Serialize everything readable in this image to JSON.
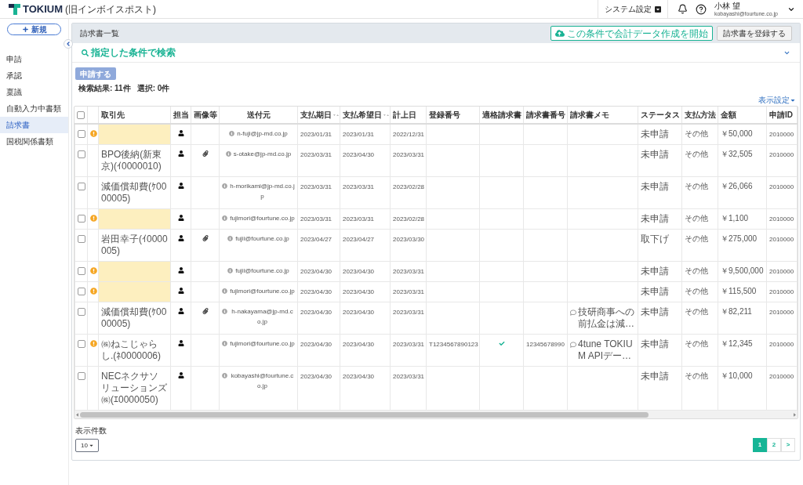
{
  "app": {
    "logo": "TOKIUM",
    "logo_note": "(旧インボイスポスト)",
    "system_settings": "システム設定",
    "user_name": "小林 望",
    "user_email": "kobayashi@fourtune.co.jp"
  },
  "sidebar": {
    "new_button": "新規",
    "items": [
      {
        "label": "申請",
        "selected": false
      },
      {
        "label": "承認",
        "selected": false
      },
      {
        "label": "稟議",
        "selected": false
      },
      {
        "label": "自動入力中書類",
        "selected": false
      },
      {
        "label": "請求書",
        "selected": true
      },
      {
        "label": "国税関係書類",
        "selected": false
      }
    ]
  },
  "panel": {
    "title": "請求書一覧",
    "export_button": "この条件で会計データ作成を開始",
    "register_button": "請求書を登録する"
  },
  "search": {
    "label": "指定した条件で検索",
    "expanded": false
  },
  "toolbar": {
    "apply_button": {
      "label": "申請する",
      "disabled": true
    },
    "result_count": "検索結果: 11件",
    "selection_count": "選択: 0件",
    "display_settings": "表示設定"
  },
  "table": {
    "select_all": {
      "checked": false
    },
    "columns": [
      {
        "label": "取引先",
        "sortable": false
      },
      {
        "label": "担当",
        "sortable": false
      },
      {
        "label": "画像等",
        "sortable": false
      },
      {
        "label": "送付元",
        "sortable": false
      },
      {
        "label": "支払期日",
        "sortable": true
      },
      {
        "label": "支払希望日",
        "sortable": true
      },
      {
        "label": "計上日",
        "sortable": false
      },
      {
        "label": "登録番号",
        "sortable": false
      },
      {
        "label": "適格請求書",
        "sortable": false
      },
      {
        "label": "請求書番号",
        "sortable": false
      },
      {
        "label": "請求書メモ",
        "sortable": false
      },
      {
        "label": "ステータス",
        "sortable": false
      },
      {
        "label": "支払方法",
        "sortable": false
      },
      {
        "label": "金額",
        "sortable": false
      },
      {
        "label": "申請ID",
        "sortable": false
      }
    ],
    "rows": [
      {
        "checked": false,
        "warning": true,
        "assigned": true,
        "attachment": false,
        "sender": "n-fuji@jp-md.co.jp",
        "due_date": "2023/01/31",
        "desired_date": "2023/01/31",
        "posting_date": "2022/12/31",
        "qualified": false,
        "status": "未申請",
        "payment_method": "その他",
        "amount": "￥50,000",
        "application_id": "2010000"
      },
      {
        "checked": false,
        "warning": false,
        "partner": "BPO後納(新東京)(ｲ0000010)",
        "assigned": true,
        "attachment": true,
        "sender": "s-otake@jp-md.co.jp",
        "due_date": "2023/03/31",
        "desired_date": "2023/04/30",
        "posting_date": "2023/03/31",
        "qualified": false,
        "status": "未申請",
        "payment_method": "その他",
        "amount": "￥32,505",
        "application_id": "2010000"
      },
      {
        "checked": false,
        "warning": false,
        "partner": "減価償却費(ｹ0000005)",
        "assigned": true,
        "attachment": false,
        "sender": "h-morikami@jp-md.co.jp",
        "due_date": "2023/03/31",
        "desired_date": "2023/03/31",
        "posting_date": "2023/02/28",
        "qualified": false,
        "status": "未申請",
        "payment_method": "その他",
        "amount": "￥26,066",
        "application_id": "2010000"
      },
      {
        "checked": false,
        "warning": true,
        "assigned": true,
        "attachment": false,
        "sender": "fujimori@fourtune.co.jp",
        "due_date": "2023/03/31",
        "desired_date": "2023/03/31",
        "posting_date": "2023/02/28",
        "qualified": false,
        "status": "未申請",
        "payment_method": "その他",
        "amount": "￥1,100",
        "application_id": "2010000"
      },
      {
        "checked": false,
        "warning": false,
        "partner": "岩田幸子(ｲ0000005)",
        "assigned": true,
        "attachment": true,
        "sender": "fujii@fourtune.co.jp",
        "due_date": "2023/04/27",
        "desired_date": "2023/04/27",
        "posting_date": "2023/03/30",
        "qualified": false,
        "status": "取下げ",
        "payment_method": "その他",
        "amount": "￥275,000",
        "application_id": "2010000"
      },
      {
        "checked": false,
        "warning": true,
        "assigned": true,
        "attachment": false,
        "sender": "fujii@fourtune.co.jp",
        "due_date": "2023/04/30",
        "desired_date": "2023/04/30",
        "posting_date": "2023/03/31",
        "qualified": false,
        "status": "未申請",
        "payment_method": "その他",
        "amount": "￥9,500,000",
        "application_id": "2010000"
      },
      {
        "checked": false,
        "warning": true,
        "assigned": true,
        "attachment": false,
        "sender": "fujimori@fourtune.co.jp",
        "due_date": "2023/04/30",
        "desired_date": "2023/04/30",
        "posting_date": "2023/03/31",
        "qualified": false,
        "status": "未申請",
        "payment_method": "その他",
        "amount": "￥115,500",
        "application_id": "2010000"
      },
      {
        "checked": false,
        "warning": false,
        "partner": "減価償却費(ｹ0000005)",
        "assigned": true,
        "attachment": true,
        "sender": "h-nakayama@jp-md.co.jp",
        "due_date": "2023/04/30",
        "desired_date": "2023/04/30",
        "posting_date": "2023/03/31",
        "qualified": false,
        "memo": "技研商事への前払金は減…",
        "status": "未申請",
        "payment_method": "その他",
        "amount": "￥82,211",
        "application_id": "2010000"
      },
      {
        "checked": false,
        "warning": true,
        "partner": "㈱ねこじゃらし.(ﾈ0000006)",
        "assigned": true,
        "attachment": false,
        "sender": "fujimori@fourtune.co.jp",
        "due_date": "2023/04/30",
        "desired_date": "2023/04/30",
        "posting_date": "2023/03/31",
        "registration_no": "T1234567890123",
        "qualified": true,
        "invoice_no": "12345678990",
        "memo": "4tune TOKIUM APIデー…",
        "status": "未申請",
        "payment_method": "その他",
        "amount": "￥12,345",
        "application_id": "2010000"
      },
      {
        "checked": false,
        "warning": false,
        "partner": "NECネクサソリューションズ㈱(ｴ0000050)",
        "assigned": true,
        "attachment": false,
        "sender": "kobayashi@fourtune.co.jp",
        "due_date": "2023/04/30",
        "desired_date": "2023/04/30",
        "posting_date": "2023/03/31",
        "qualified": false,
        "status": "未申請",
        "payment_method": "その他",
        "amount": "￥10,000",
        "application_id": "2010000"
      }
    ]
  },
  "footer": {
    "page_size_label": "表示件数",
    "page_size": "10",
    "pages": [
      {
        "label": "1",
        "selected": true
      },
      {
        "label": "2",
        "selected": false
      }
    ],
    "next": ">"
  }
}
